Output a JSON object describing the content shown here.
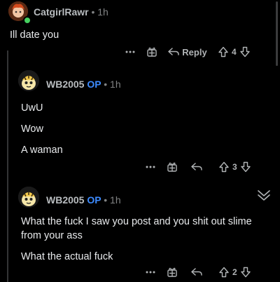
{
  "colors": {
    "background": "#000000",
    "op_badge": "#3d8bff",
    "thread_line": "#343536",
    "online_dot": "#46d160"
  },
  "comments": [
    {
      "username": "CatgirlRawr",
      "op_badge": "",
      "age": "1h",
      "body": [
        "Ill date you"
      ],
      "actions": {
        "more_icon": "more-dots-icon",
        "award_icon": "award-icon",
        "reply_label": "Reply",
        "score": "4"
      }
    },
    {
      "username": "WB2005",
      "op_badge": "OP",
      "age": "1h",
      "body": [
        "UwU",
        "Wow",
        "A waman"
      ],
      "actions": {
        "more_icon": "more-dots-icon",
        "award_icon": "award-icon",
        "reply_label": "",
        "score": "3"
      }
    },
    {
      "username": "WB2005",
      "op_badge": "OP",
      "age": "1h",
      "body": [
        "What the fuck I saw you post and you shit out slime from your ass",
        "What the actual fuck"
      ],
      "actions": {
        "more_icon": "more-dots-icon",
        "award_icon": "award-icon",
        "reply_label": "",
        "score": "2"
      }
    }
  ],
  "separator": "•"
}
